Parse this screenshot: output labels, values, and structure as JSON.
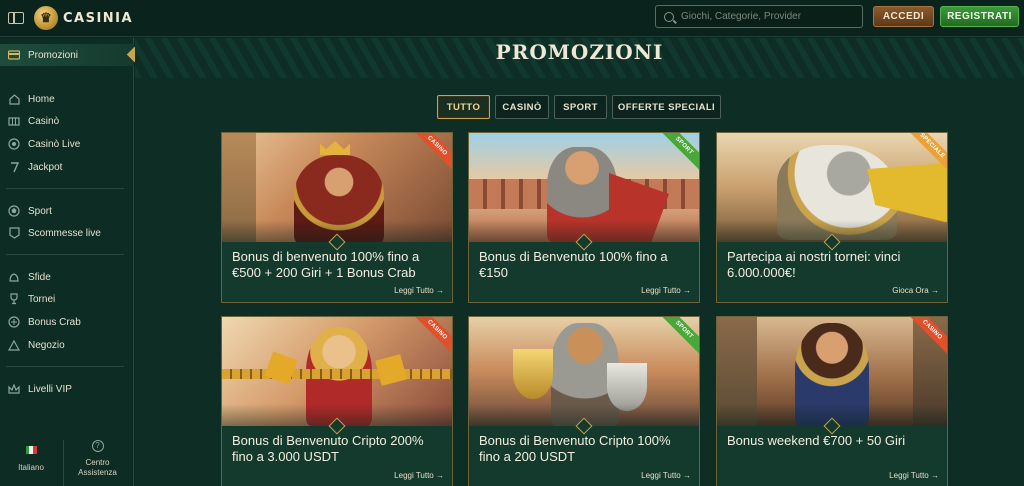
{
  "brand": {
    "name": "CASINIA"
  },
  "header": {
    "search_placeholder": "Giochi, Categorie, Provider",
    "login_label": "ACCEDI",
    "register_label": "REGISTRATI"
  },
  "sidebar": {
    "active": {
      "label": "Promozioni",
      "icon": "promo-card-icon"
    },
    "items": [
      {
        "label": "Home",
        "icon": "home-icon"
      },
      {
        "label": "Casinò",
        "icon": "casino-icon"
      },
      {
        "label": "Casinò Live",
        "icon": "live-icon"
      },
      {
        "label": "Jackpot",
        "icon": "jackpot-icon"
      },
      {
        "label": "Sport",
        "icon": "sport-ball-icon"
      },
      {
        "label": "Scommesse live",
        "icon": "live-bet-icon"
      },
      {
        "label": "Sfide",
        "icon": "challenge-icon"
      },
      {
        "label": "Tornei",
        "icon": "trophy-icon"
      },
      {
        "label": "Bonus Crab",
        "icon": "crab-icon"
      },
      {
        "label": "Negozio",
        "icon": "shop-icon"
      },
      {
        "label": "Livelli VIP",
        "icon": "vip-icon"
      }
    ],
    "language": "Italiano",
    "help": "Centro Assistenza"
  },
  "main": {
    "title": "PROMOZIONI",
    "tabs": [
      "TUTTO",
      "CASINÒ",
      "SPORT",
      "OFFERTE SPECIALI"
    ],
    "active_tab": "TUTTO",
    "cards": [
      {
        "title": "Bonus di benvenuto 100% fino a €500 + 200 Giri + 1 Bonus Crab",
        "link": "Leggi Tutto",
        "ribbon": "CASINO"
      },
      {
        "title": "Bonus di Benvenuto 100% fino a €150",
        "link": "Leggi Tutto",
        "ribbon": "SPORT"
      },
      {
        "title": "Partecipa ai nostri tornei: vinci 6.000.000€!",
        "link": "Gioca Ora",
        "ribbon": "SPECIALE"
      },
      {
        "title": "Bonus di Benvenuto Cripto 200% fino a 3.000 USDT",
        "link": "Leggi Tutto",
        "ribbon": "CASINO"
      },
      {
        "title": "Bonus di Benvenuto Cripto 100% fino a 200 USDT",
        "link": "Leggi Tutto",
        "ribbon": "SPORT"
      },
      {
        "title": "Bonus weekend €700 + 50 Giri",
        "link": "Leggi Tutto",
        "ribbon": "CASINO"
      }
    ]
  },
  "colors": {
    "background": "#0e2e25",
    "gold_accent": "#c9a34e",
    "register_green": "#3c9a3a",
    "login_brown": "#8a5a2f"
  }
}
